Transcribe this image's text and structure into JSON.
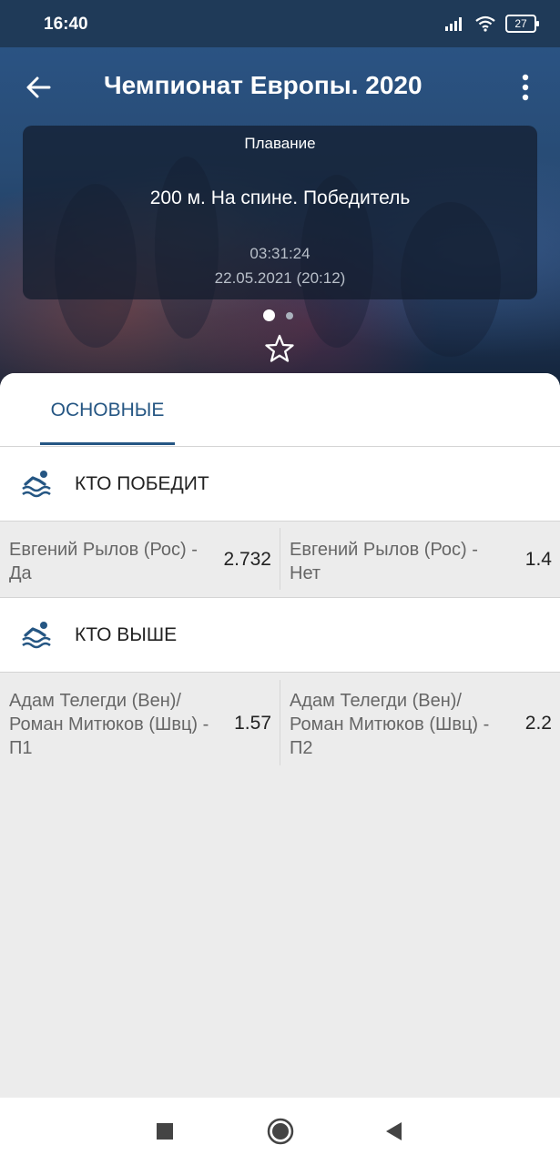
{
  "status_bar": {
    "time": "16:40",
    "battery": "27"
  },
  "header": {
    "title": "Чемпионат Европы. 2020"
  },
  "event": {
    "sport": "Плавание",
    "name": "200 м. На спине. Победитель",
    "timer": "03:31:24",
    "date": "22.05.2021 (20:12)"
  },
  "tabs": [
    {
      "label": "ОСНОВНЫЕ",
      "active": true
    }
  ],
  "markets": [
    {
      "title": "КТО ПОБЕДИТ",
      "icon": "swimmer-icon",
      "outcomes": [
        {
          "label": "Евгений Рылов (Рос) - Да",
          "odds": "2.732"
        },
        {
          "label": "Евгений Рылов (Рос) - Нет",
          "odds": "1.4"
        }
      ]
    },
    {
      "title": "КТО ВЫШЕ",
      "icon": "swimmer-icon",
      "outcomes": [
        {
          "label": "Адам Телегди (Вен)/ Роман Митюков (Швц) - П1",
          "odds": "1.57"
        },
        {
          "label": "Адам Телегди (Вен)/ Роман Митюков (Швц) - П2",
          "odds": "2.2"
        }
      ]
    }
  ],
  "colors": {
    "accent": "#255683",
    "header_bg": "#1f3a58"
  }
}
